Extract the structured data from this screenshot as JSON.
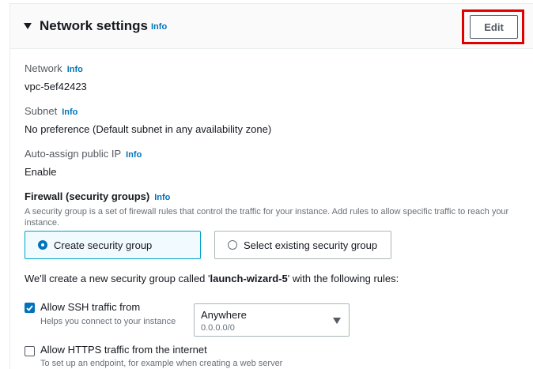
{
  "header": {
    "title": "Network settings",
    "info": "Info",
    "edit_label": "Edit"
  },
  "network": {
    "label": "Network",
    "info": "Info",
    "value": "vpc-5ef42423"
  },
  "subnet": {
    "label": "Subnet",
    "info": "Info",
    "value": "No preference (Default subnet in any availability zone)"
  },
  "public_ip": {
    "label": "Auto-assign public IP",
    "info": "Info",
    "value": "Enable"
  },
  "firewall": {
    "title": "Firewall (security groups)",
    "info": "Info",
    "description": "A security group is a set of firewall rules that control the traffic for your instance. Add rules to allow specific traffic to reach your instance.",
    "options": [
      {
        "label": "Create security group",
        "selected": true
      },
      {
        "label": "Select existing security group",
        "selected": false
      }
    ],
    "note_prefix": "We'll create a new security group called '",
    "group_name": "launch-wizard-5",
    "note_suffix": "' with the following rules:"
  },
  "rules": {
    "ssh": {
      "label": "Allow SSH traffic from",
      "help": "Helps you connect to your instance",
      "checked": true,
      "source_value": "Anywhere",
      "source_sub": "0.0.0.0/0"
    },
    "https": {
      "label": "Allow HTTPS traffic from the internet",
      "help": "To set up an endpoint, for example when creating a web server",
      "checked": false
    }
  },
  "colors": {
    "link": "#0073bb",
    "highlight": "#e00000",
    "selected_tile_bg": "#f1faff",
    "selected_tile_border": "#00a1c9"
  }
}
